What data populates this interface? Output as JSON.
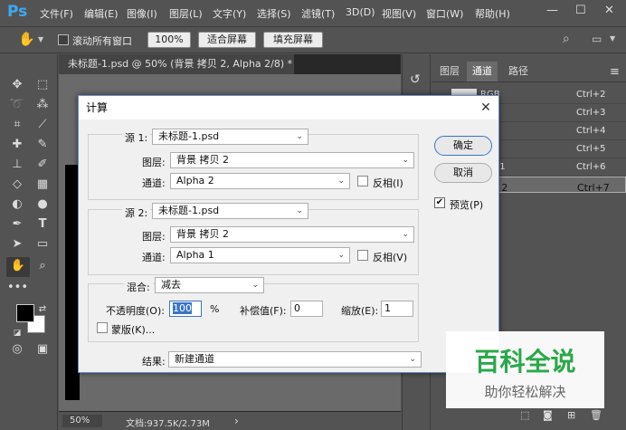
{
  "app": {
    "logo": "Ps"
  },
  "menu": [
    "文件(F)",
    "编辑(E)",
    "图像(I)",
    "图层(L)",
    "文字(Y)",
    "选择(S)",
    "滤镜(T)",
    "3D(D)",
    "视图(V)",
    "窗口(W)",
    "帮助(H)"
  ],
  "window_controls": {
    "minimize": "—",
    "maximize": "☐",
    "close": "✕"
  },
  "options_bar": {
    "scroll_all_label": "滚动所有窗口",
    "zoom_value": "100%",
    "fit_screen_label": "适合屏幕",
    "fill_screen_label": "填充屏幕"
  },
  "document": {
    "tab_title": "未标题-1.psd @ 50% (背景 拷贝 2, Alpha 2/8) *",
    "tab_close": "×",
    "status_zoom": "50%",
    "status_doc": "文档:937.5K/2.73M",
    "status_arrow": "›"
  },
  "panel": {
    "tabs": [
      "图层",
      "通道",
      "路径"
    ],
    "menu_icon": "≡",
    "channels": [
      {
        "name": "RGB",
        "shortcut": "Ctrl+2"
      },
      {
        "name": "",
        "shortcut": "Ctrl+3"
      },
      {
        "name": "",
        "shortcut": "Ctrl+4"
      },
      {
        "name": "",
        "shortcut": "Ctrl+5"
      },
      {
        "name": "a 1",
        "shortcut": "Ctrl+6"
      },
      {
        "name": "a 2",
        "shortcut": "Ctrl+7"
      }
    ]
  },
  "dialog": {
    "title": "计算",
    "close": "✕",
    "source1": {
      "label": "源 1:",
      "file": "未标题-1.psd",
      "layer_label": "图层:",
      "layer": "背景 拷贝 2",
      "channel_label": "通道:",
      "channel": "Alpha 2",
      "invert_label": "反相(I)"
    },
    "source2": {
      "label": "源 2:",
      "file": "未标题-1.psd",
      "layer_label": "图层:",
      "layer": "背景 拷贝 2",
      "channel_label": "通道:",
      "channel": "Alpha 1",
      "invert_label": "反相(V)"
    },
    "blend": {
      "label": "混合:",
      "mode": "减去",
      "opacity_label": "不透明度(O):",
      "opacity": "100",
      "percent": "%",
      "offset_label": "补偿值(F):",
      "offset": "0",
      "scale_label": "缩放(E):",
      "scale": "1",
      "mask_label": "蒙版(K)..."
    },
    "result_label": "结果:",
    "result": "新建通道",
    "ok": "确定",
    "cancel": "取消",
    "preview_label": "预览(P)"
  },
  "watermark": {
    "title": "百科全说",
    "subtitle": "助你轻松解决"
  },
  "colors": {
    "accent": "#3da8f5",
    "watermark_green": "#2aa84a",
    "dialog_bg": "#f0f0f0",
    "ui_bg": "#535353"
  }
}
